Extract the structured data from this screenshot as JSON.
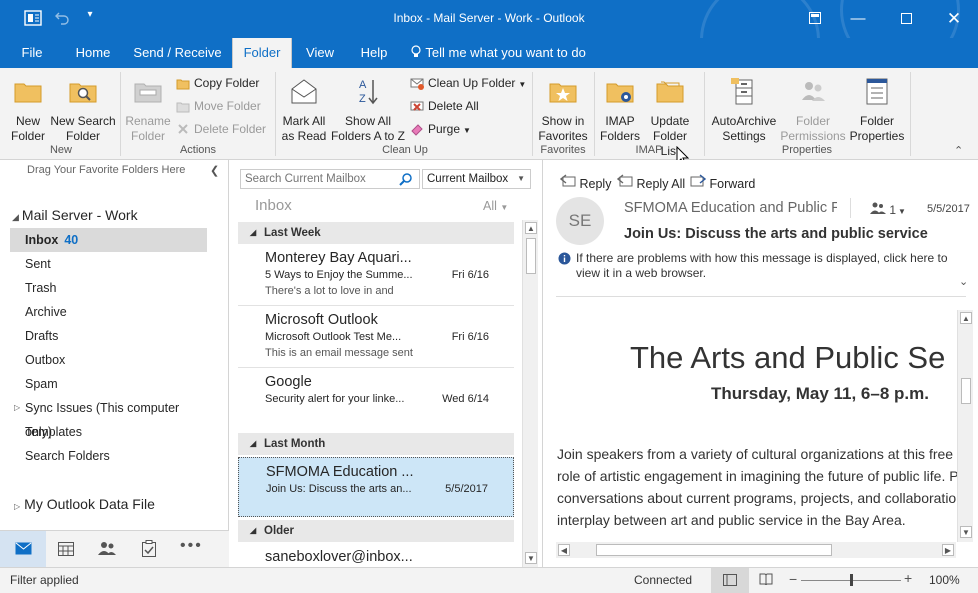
{
  "titlebar": {
    "title": "Inbox - Mail Server - Work  -  Outlook",
    "undo_icon": "undo-icon",
    "app_icon": "outlook-icon"
  },
  "menu": {
    "tabs": [
      "File",
      "Home",
      "Send / Receive",
      "Folder",
      "View",
      "Help"
    ],
    "active_tab": "Folder",
    "tell_me": "Tell me what you want to do"
  },
  "ribbon": {
    "new_folder": "New Folder",
    "new_search_folder": "New Search Folder",
    "group_new": "New",
    "rename_folder": "Rename Folder",
    "copy_folder": "Copy Folder",
    "move_folder": "Move Folder",
    "delete_folder": "Delete Folder",
    "group_actions": "Actions",
    "mark_all_as_read": "Mark All as Read",
    "show_all_folders": "Show All Folders A to Z",
    "clean_up_folder": "Clean Up Folder",
    "delete_all": "Delete All",
    "purge": "Purge",
    "group_clean_up": "Clean Up",
    "show_in_favorites": "Show in Favorites",
    "group_favorites": "Favorites",
    "imap_folders": "IMAP Folders",
    "update_folder_list": "Update Folder List",
    "group_imap": "IMAP",
    "autoarchive": "AutoArchive Settings",
    "folder_permissions": "Folder Permissions",
    "folder_properties": "Folder Properties",
    "group_properties": "Properties"
  },
  "folders": {
    "favorites_hint": "Drag Your Favorite Folders Here",
    "account": "Mail Server - Work",
    "items": [
      {
        "label": "Inbox",
        "count": "40"
      },
      {
        "label": "Sent"
      },
      {
        "label": "Trash"
      },
      {
        "label": "Archive"
      },
      {
        "label": "Drafts"
      },
      {
        "label": "Outbox"
      },
      {
        "label": "Spam"
      },
      {
        "label": "Sync Issues (This computer only)"
      },
      {
        "label": "Templates"
      },
      {
        "label": "Search Folders"
      }
    ],
    "data_file": "My Outlook Data File"
  },
  "maillist": {
    "search_placeholder": "Search Current Mailbox",
    "scope": "Current Mailbox",
    "folder_title": "Inbox",
    "filter": "All",
    "groups": [
      "Last Week",
      "Last Month",
      "Older"
    ],
    "messages": [
      {
        "from": "Monterey Bay Aquari...",
        "subject": "5 Ways to Enjoy the Summe...",
        "preview": "There's a lot to love in and",
        "date": "Fri 6/16"
      },
      {
        "from": "Microsoft Outlook",
        "subject": "Microsoft Outlook Test Me...",
        "preview": "This is an email message sent",
        "date": "Fri 6/16"
      },
      {
        "from": "Google",
        "subject": "Security alert for your linke...",
        "preview": "",
        "date": "Wed 6/14"
      },
      {
        "from": "SFMOMA Education ...",
        "subject": "Join Us: Discuss the arts an...",
        "preview": "",
        "date": "5/5/2017"
      },
      {
        "from": "saneboxlover@inbox...",
        "subject": "",
        "preview": "",
        "date": ""
      }
    ]
  },
  "reading": {
    "reply": "Reply",
    "reply_all": "Reply All",
    "forward": "Forward",
    "avatar_initials": "SE",
    "sender": "SFMOMA Education and Public F",
    "people_count": "1",
    "date": "5/5/2017",
    "subject": "Join Us: Discuss the arts and public service",
    "info": "If there are problems with how this message is displayed, click here to view it in a web browser.",
    "body_title": "The Arts and Public Se",
    "body_date": "Thursday, May 11, 6–8 p.m.",
    "body_lines": [
      "Join speakers from a variety of cultural organizations at this free",
      "role of artistic engagement in imagining the future of public life. P",
      "conversations about current programs, projects, and collaboratio",
      "interplay between art and public service in the Bay Area."
    ]
  },
  "status": {
    "left": "Filter applied",
    "connected": "Connected",
    "zoom": "100%",
    "zoom_level": 0.5
  }
}
